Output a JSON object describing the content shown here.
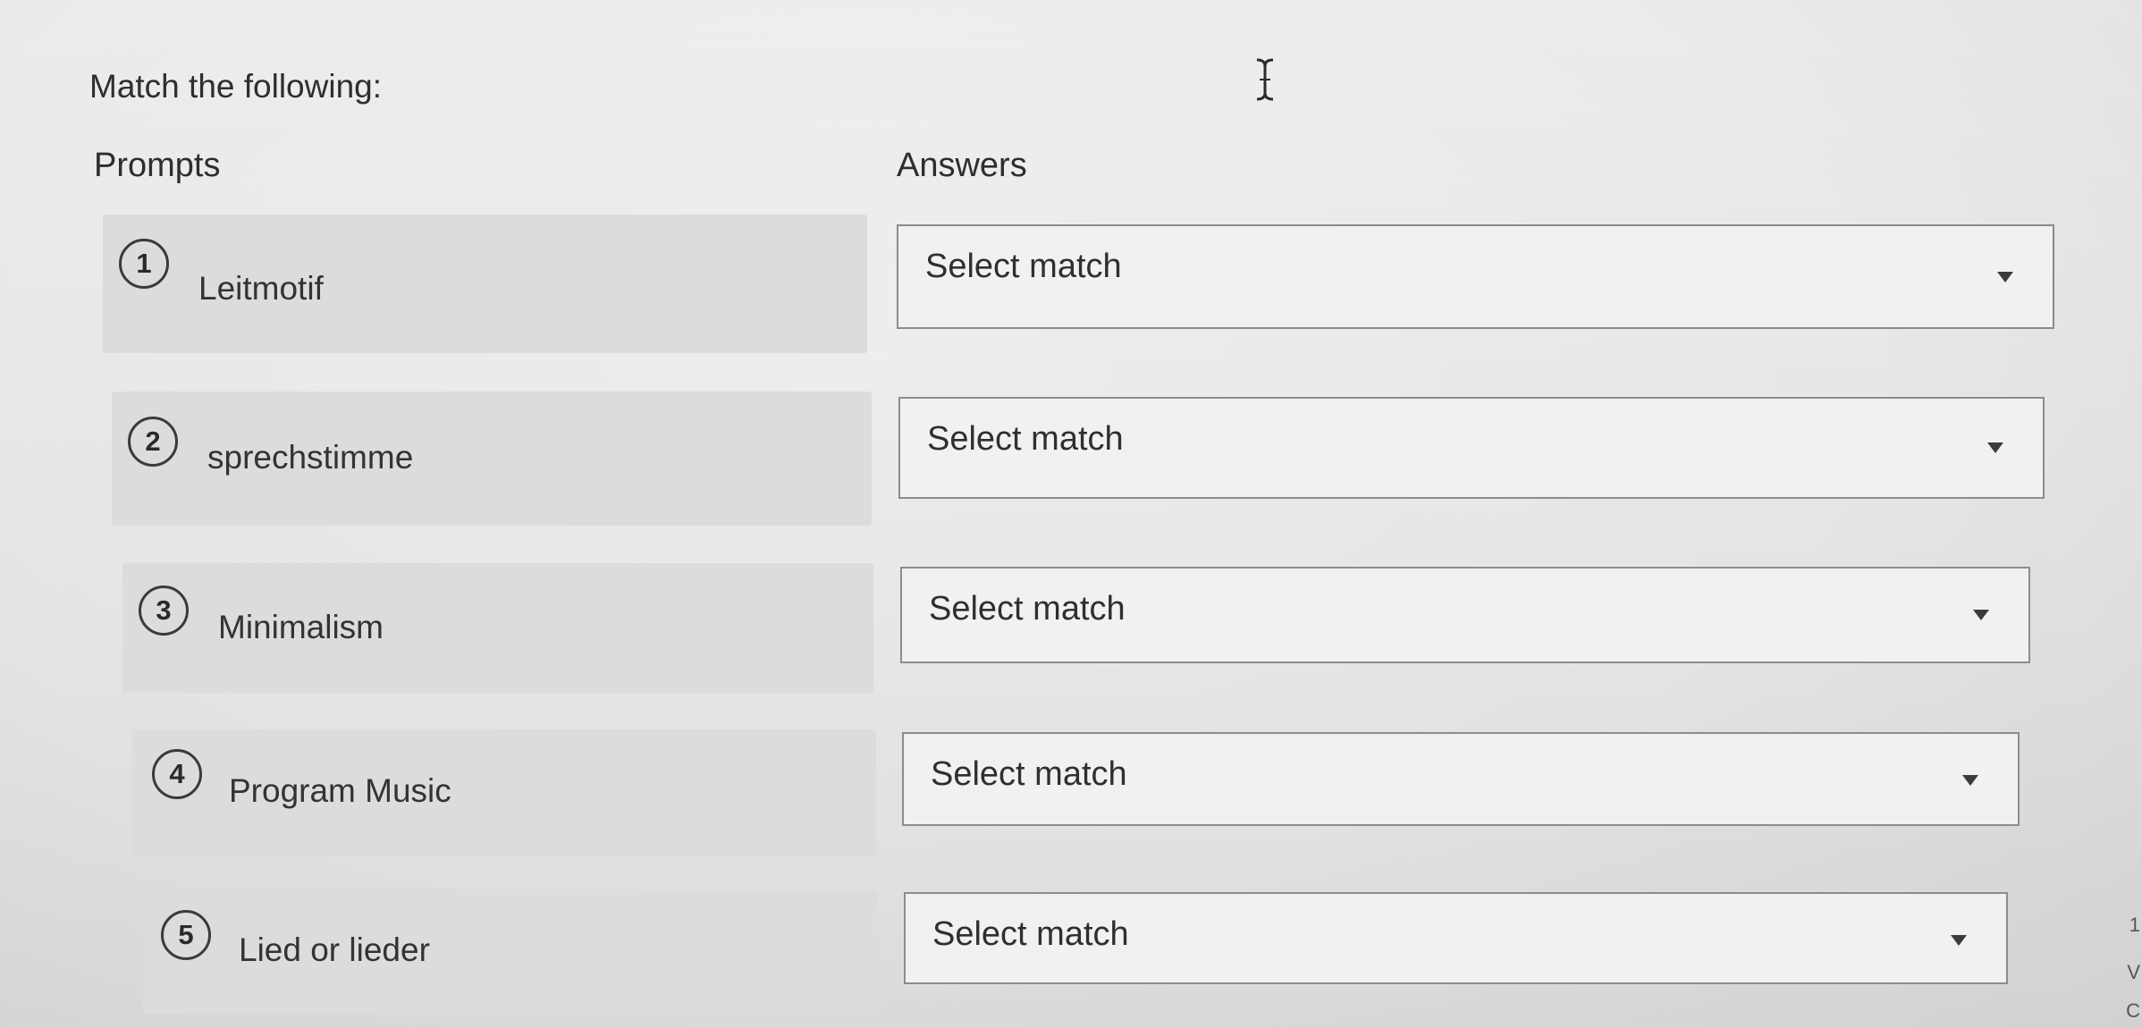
{
  "question": {
    "title": "Match the following:"
  },
  "columns": {
    "prompts_header": "Prompts",
    "answers_header": "Answers"
  },
  "rows": [
    {
      "number": "1",
      "prompt": "Leitmotif",
      "answer_value": "Select match"
    },
    {
      "number": "2",
      "prompt": "sprechstimme",
      "answer_value": "Select match"
    },
    {
      "number": "3",
      "prompt": "Minimalism",
      "answer_value": "Select match"
    },
    {
      "number": "4",
      "prompt": "Program Music",
      "answer_value": "Select match"
    },
    {
      "number": "5",
      "prompt": "Lied or lieder",
      "answer_value": "Select match"
    }
  ],
  "edge_fragments": [
    "1",
    "V",
    "C"
  ],
  "icons": {
    "dropdown": "caret-down-icon",
    "cursor": "text-cursor-icon"
  }
}
